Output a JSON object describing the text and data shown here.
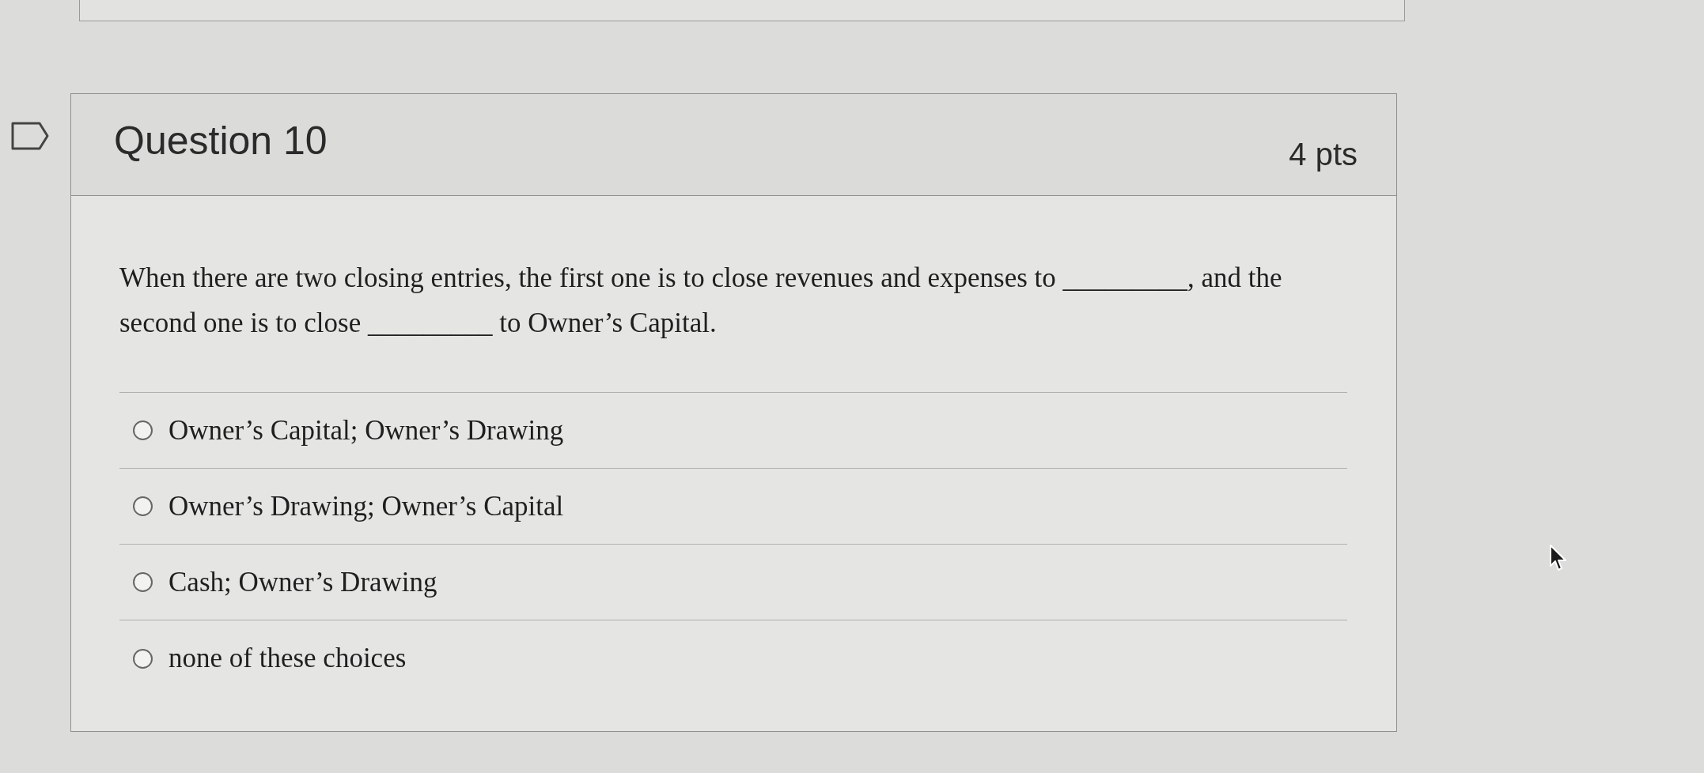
{
  "question": {
    "title": "Question 10",
    "points": "4 pts",
    "text": "When there are two closing entries, the first one is to close revenues and expenses to _________, and the second one is to close _________ to Owner’s Capital.",
    "options": [
      {
        "label": "Owner’s Capital; Owner’s Drawing",
        "selected": false
      },
      {
        "label": "Owner’s Drawing; Owner’s Capital",
        "selected": false
      },
      {
        "label": "Cash; Owner’s Drawing",
        "selected": false
      },
      {
        "label": "none of these choices",
        "selected": false
      }
    ]
  }
}
